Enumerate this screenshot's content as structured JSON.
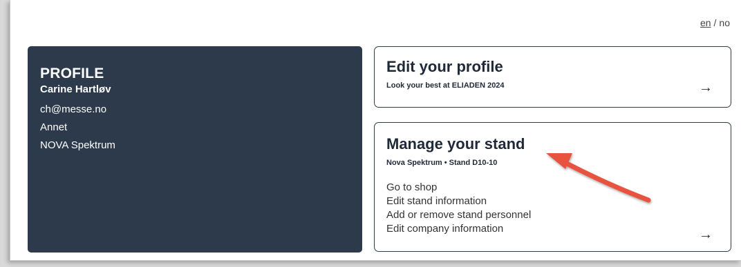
{
  "lang": {
    "en": "en",
    "sep": "/",
    "no": "no"
  },
  "profile": {
    "title": "PROFILE",
    "name": "Carine Hartløv",
    "email": "ch@messe.no",
    "role": "Annet",
    "company": "NOVA Spektrum"
  },
  "edit_profile": {
    "title": "Edit your profile",
    "subtitle": "Look your best at ELIADEN 2024",
    "arrow": "→"
  },
  "manage_stand": {
    "title": "Manage your stand",
    "subtitle": "Nova Spektrum • Stand D10-10",
    "links": [
      "Go to shop",
      "Edit stand information",
      "Add or remove stand personnel",
      "Edit company information"
    ],
    "arrow": "→"
  },
  "annotation": {
    "color": "#e8523f"
  }
}
